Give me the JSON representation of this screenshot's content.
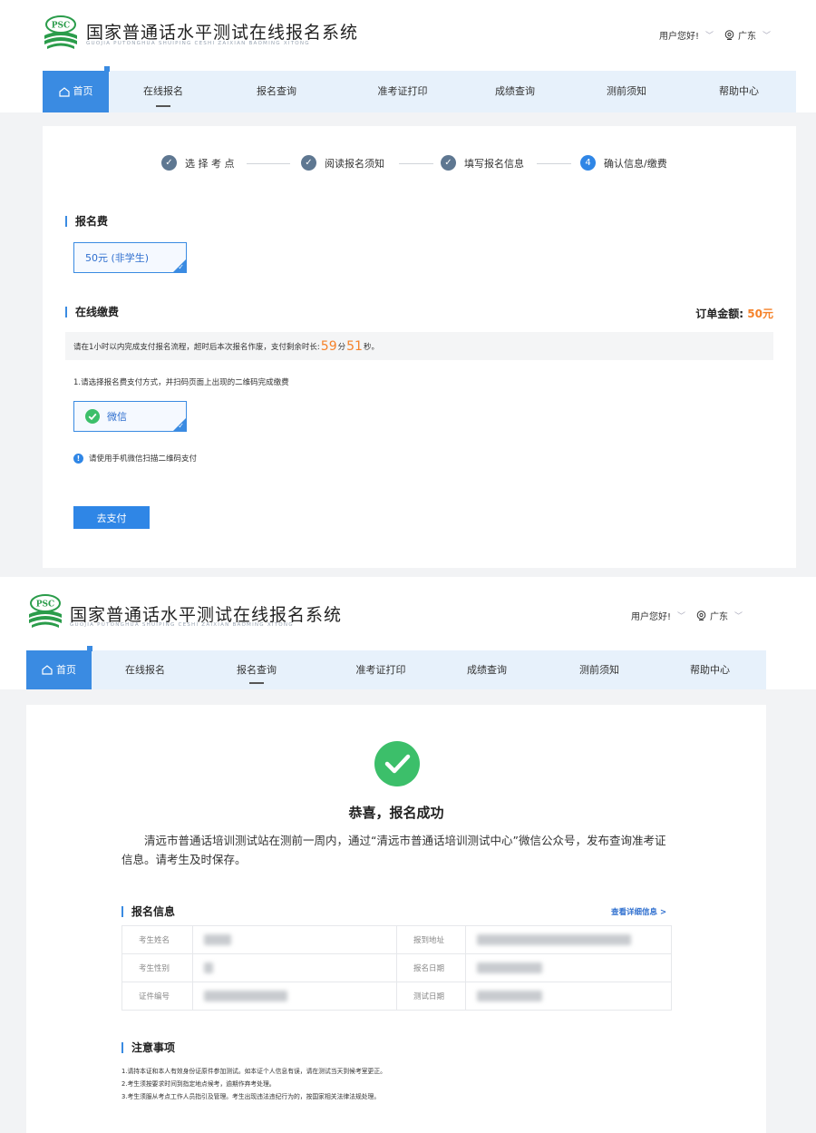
{
  "colors": {
    "brand_blue": "#3a8be2",
    "nav_bg": "#e7f1fb",
    "accent_orange": "#f5822a",
    "success_green": "#3cbf6a",
    "logo_green": "#2a9c4a"
  },
  "site": {
    "logo_text": "PSC",
    "title": "国家普通话水平测试在线报名系统",
    "subtitle": "GUOJIA PUTONGHUA SHUIPING CESHI ZAIXIAN BAOMING XITONG",
    "user_greeting": "用户您好!",
    "location": "广东"
  },
  "nav": {
    "items": [
      {
        "label": "首页",
        "icon": "home-icon"
      },
      {
        "label": "在线报名"
      },
      {
        "label": "报名查询"
      },
      {
        "label": "准考证打印"
      },
      {
        "label": "成绩查询"
      },
      {
        "label": "测前须知"
      },
      {
        "label": "帮助中心"
      }
    ]
  },
  "payment_page": {
    "steps": [
      {
        "label": "选 择 考 点",
        "state": "done"
      },
      {
        "label": "阅读报名须知",
        "state": "done"
      },
      {
        "label": "填写报名信息",
        "state": "done"
      },
      {
        "label": "确认信息/缴费",
        "state": "current",
        "number": "4"
      }
    ],
    "fee_section_title": "报名费",
    "fee_option": "50元 (非学生)",
    "payment_section_title": "在线缴费",
    "order_label": "订单金额:",
    "order_amount": "50元",
    "notice_prefix": "请在1小时以内完成支付报名流程，超时后本次报名作废，支付剩余时长:",
    "countdown_min": "59",
    "min_unit": "分",
    "countdown_sec": "51",
    "sec_unit": "秒。",
    "instruction": "1.请选择报名费支付方式，并扫码页面上出现的二维码完成缴费",
    "pay_method": "微信",
    "hint": "请使用手机微信扫描二维码支付",
    "pay_button": "去支付"
  },
  "success_page": {
    "title": "恭喜，报名成功",
    "description": "清远市普通话培训测试站在测前一周内，通过“清远市普通话培训测试中心”微信公众号，发布查询准考证信息。请考生及时保存。",
    "info_title": "报名信息",
    "detail_link": "查看详细信息 >",
    "table": [
      {
        "label_left": "考生姓名",
        "label_right": "报到地址"
      },
      {
        "label_left": "考生性别",
        "label_right": "报名日期"
      },
      {
        "label_left": "证件编号",
        "label_right": "测试日期"
      }
    ],
    "notes_title": "注意事项",
    "notes": [
      "1.请持本证和本人有效身份证原件参加测试。如本证个人信息有误，请在测试当天到候考室更正。",
      "2.考生须按要求时间到指定地点候考，逾期作弃考处理。",
      "3.考生须服从考点工作人员指引及管理。考生出现违法违纪行为的，按国家相关法律法规处理。"
    ]
  }
}
